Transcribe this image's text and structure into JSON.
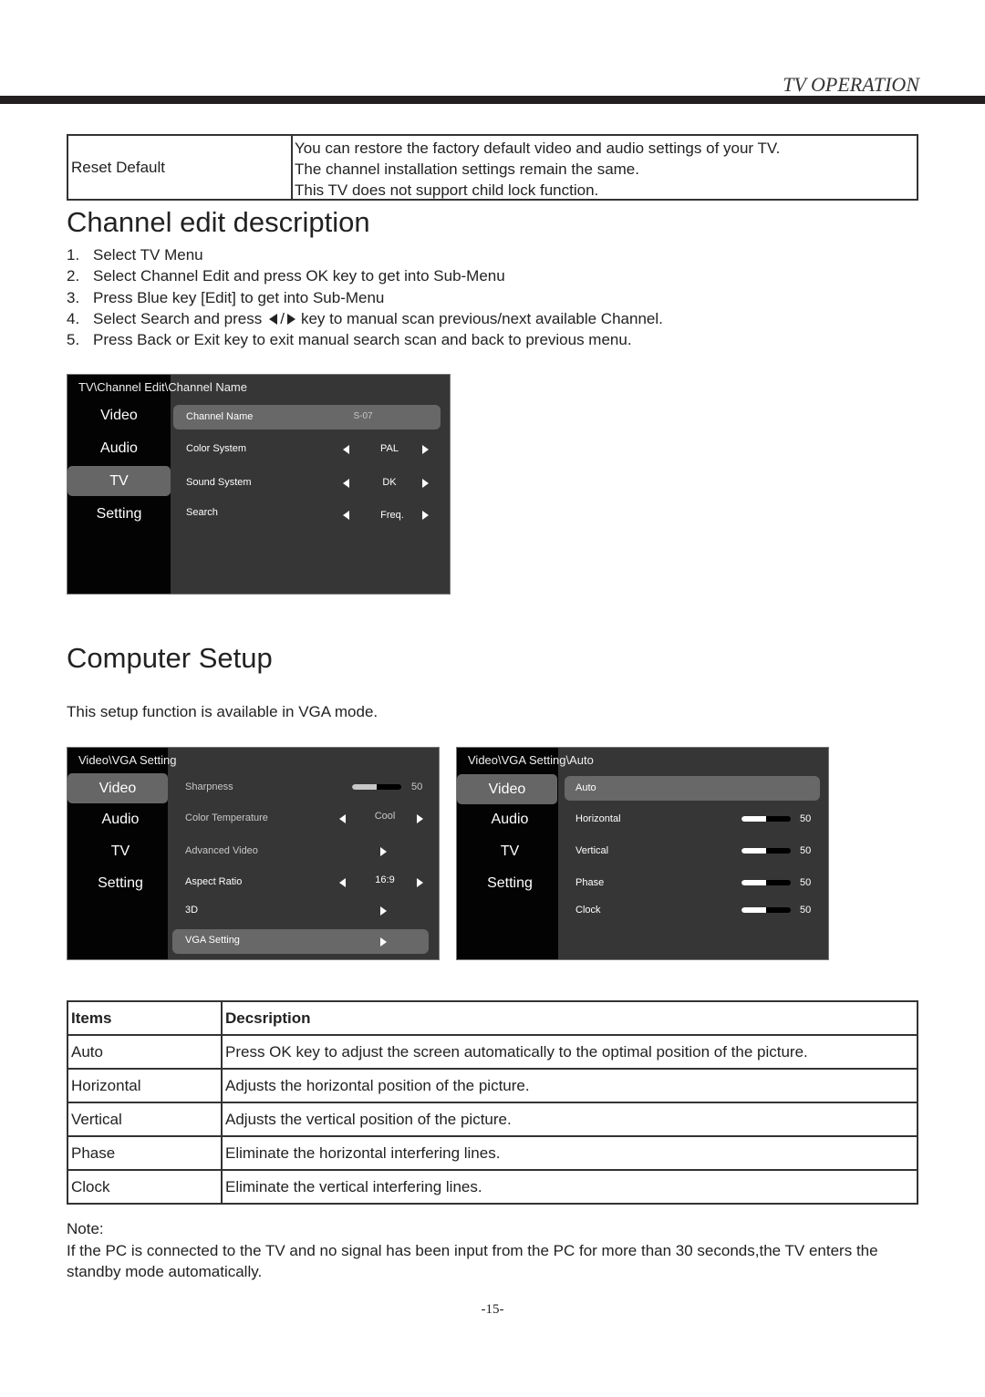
{
  "header": {
    "section": "TV OPERATION"
  },
  "reset_table": {
    "label": "Reset Default",
    "lines": [
      "You can restore the factory default video and audio settings of your TV.",
      "The channel installation settings remain the same.",
      "This TV does not support child lock function."
    ]
  },
  "channel_edit": {
    "title": "Channel edit description",
    "steps": [
      {
        "num": "1.",
        "text": "Select TV Menu"
      },
      {
        "num": "2.",
        "text": "Select Channel Edit and press OK key to get into Sub-Menu"
      },
      {
        "num": "3.",
        "text": "Press Blue key [Edit] to get into Sub-Menu"
      },
      {
        "num": "4.",
        "text_before": "Select Search and press",
        "key_icons": [
          "left-arrow",
          "/",
          "right-arrow"
        ],
        "text_after": "key to manual scan previous/next available Channel."
      },
      {
        "num": "5.",
        "text": "Press Back or Exit key to exit manual search scan and back to previous menu."
      }
    ],
    "menu": {
      "breadcrumb": "TV\\Channel Edit\\Channel Name",
      "categories": [
        "Video",
        "Audio",
        "TV",
        "Setting"
      ],
      "selected_category": "TV",
      "rows": [
        {
          "label": "Channel Name",
          "value": "S-07",
          "selected": true
        },
        {
          "label": "Color System",
          "value": "PAL",
          "arrows": true
        },
        {
          "label": "Sound System",
          "value": "DK",
          "arrows": true
        },
        {
          "label": "Search",
          "value": "Freq.",
          "arrows": true
        }
      ]
    }
  },
  "computer_setup": {
    "title": "Computer Setup",
    "intro": "This setup function is available in VGA mode.",
    "menu_vga": {
      "breadcrumb": "Video\\VGA Setting",
      "categories": [
        "Video",
        "Audio",
        "TV",
        "Setting"
      ],
      "selected_category": "Video",
      "rows": [
        {
          "label": "Sharpness",
          "type": "slider",
          "value": "50",
          "level_percent": 50,
          "dimmed": true
        },
        {
          "label": "Color Temperature",
          "value": "Cool",
          "arrows": true,
          "dimmed": true
        },
        {
          "label": "Advanced Video",
          "type": "submenu",
          "dimmed": true
        },
        {
          "label": "Aspect Ratio",
          "value": "16:9",
          "arrows": true
        },
        {
          "label": "3D",
          "type": "submenu"
        },
        {
          "label": "VGA Setting",
          "type": "submenu",
          "selected": true
        }
      ]
    },
    "menu_auto": {
      "breadcrumb": "Video\\VGA Setting\\Auto",
      "categories": [
        "Video",
        "Audio",
        "TV",
        "Setting"
      ],
      "selected_category": "Video",
      "rows": [
        {
          "label": "Auto",
          "selected": true
        },
        {
          "label": "Horizontal",
          "type": "slider",
          "value": "50",
          "level_percent": 50
        },
        {
          "label": "Vertical",
          "type": "slider",
          "value": "50",
          "level_percent": 50
        },
        {
          "label": "Phase",
          "type": "slider",
          "value": "50",
          "level_percent": 50
        },
        {
          "label": "Clock",
          "type": "slider",
          "value": "50",
          "level_percent": 50
        }
      ]
    },
    "items_table": {
      "headers": [
        "Items",
        "Decsription"
      ],
      "rows": [
        [
          "Auto",
          "Press OK key to adjust the screen automatically to the optimal position of the picture."
        ],
        [
          "Horizontal",
          "Adjusts the horizontal position of the picture."
        ],
        [
          "Vertical",
          "Adjusts the vertical position of the picture."
        ],
        [
          "Phase",
          "Eliminate the horizontal interfering lines."
        ],
        [
          "Clock",
          "Eliminate the vertical interfering lines."
        ]
      ]
    },
    "note_label": "Note:",
    "note_text": "If the PC is connected to the TV and no signal has been input from the PC for more than 30 seconds,the TV enters the standby mode automatically."
  },
  "page_number": "-15-"
}
